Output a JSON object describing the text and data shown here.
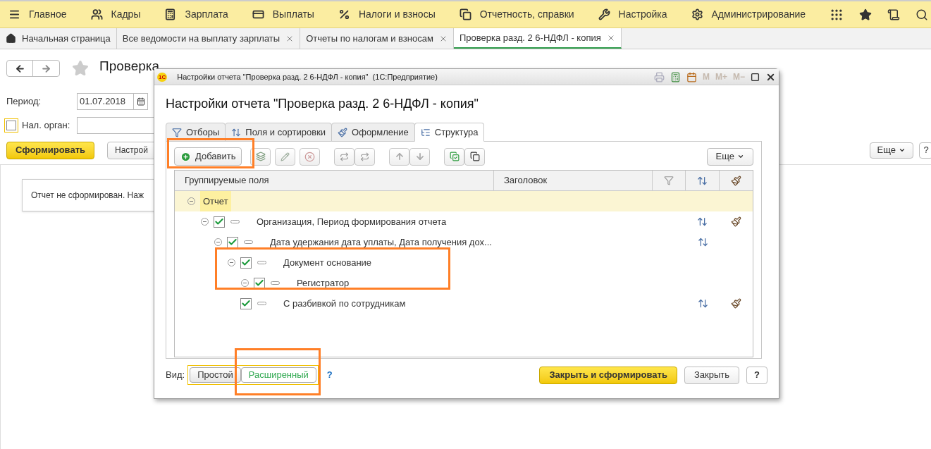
{
  "menu": [
    "Главное",
    "Кадры",
    "Зарплата",
    "Выплаты",
    "Налоги и взносы",
    "Отчетность, справки",
    "Настройка",
    "Администрирование"
  ],
  "tabs": [
    {
      "label": "Начальная страница",
      "selected": false
    },
    {
      "label": "Все ведомости на выплату зарплаты",
      "selected": false
    },
    {
      "label": "Отчеты по налогам и взносам",
      "selected": false
    },
    {
      "label": "Проверка разд. 2 6-НДФЛ - копия",
      "selected": true
    }
  ],
  "page": {
    "title": "Проверка",
    "period_label": "Период:",
    "period_value": "01.07.2018",
    "tax_label": "Нал. орган:",
    "tax_checked": false,
    "generate": "Сформировать",
    "settings": "Настрой",
    "more": "Еще",
    "help": "?",
    "message": "Отчет не сформирован. Наж"
  },
  "dialog": {
    "window_title": "Настройки отчета \"Проверка разд. 2 6-НДФЛ - копия\"  (1С:Предприятие)",
    "logo": "1С",
    "title": "Настройки отчета \"Проверка разд. 2 6-НДФЛ - копия\"",
    "title_buttons": [
      "M",
      "M+",
      "M−"
    ],
    "tabs": [
      {
        "label": "Отборы",
        "selected": false
      },
      {
        "label": "Поля и сортировки",
        "selected": false
      },
      {
        "label": "Оформление",
        "selected": false
      },
      {
        "label": "Структура",
        "selected": true
      }
    ],
    "add": "Добавить",
    "more": "Еще",
    "columns": [
      "Группируемые поля",
      "Заголовок"
    ],
    "tree": [
      {
        "label": "Отчет",
        "selected": true,
        "checkable": false,
        "expanded": true,
        "fields_icon": false,
        "style_icon": false,
        "children": [
          {
            "label": "Организация, Период формирования отчета",
            "selected": false,
            "checkable": true,
            "checked": true,
            "expanded": true,
            "fields_icon": true,
            "style_icon": true,
            "children": [
              {
                "label": "Дата удержания дата уплаты, Дата получения дох...",
                "selected": false,
                "checkable": true,
                "checked": true,
                "expanded": true,
                "fields_icon": true,
                "style_icon": false,
                "children": [
                  {
                    "label": "Документ основание",
                    "selected": false,
                    "checkable": true,
                    "checked": true,
                    "expanded": true,
                    "fields_icon": false,
                    "style_icon": false,
                    "children": [
                      {
                        "label": "Регистратор",
                        "selected": false,
                        "checkable": true,
                        "checked": true,
                        "expanded": true,
                        "fields_icon": false,
                        "style_icon": false
                      }
                    ]
                  },
                  {
                    "label": "С разбивкой по сотрудникам",
                    "selected": false,
                    "checkable": true,
                    "checked": true,
                    "fields_icon": true,
                    "style_icon": true
                  }
                ]
              }
            ]
          }
        ]
      }
    ],
    "view_label": "Вид:",
    "views": [
      {
        "label": "Простой",
        "selected": false
      },
      {
        "label": "Расширенный",
        "selected": true
      }
    ],
    "view_help": "?",
    "close_generate": "Закрыть и сформировать",
    "close": "Закрыть",
    "help": "?"
  }
}
